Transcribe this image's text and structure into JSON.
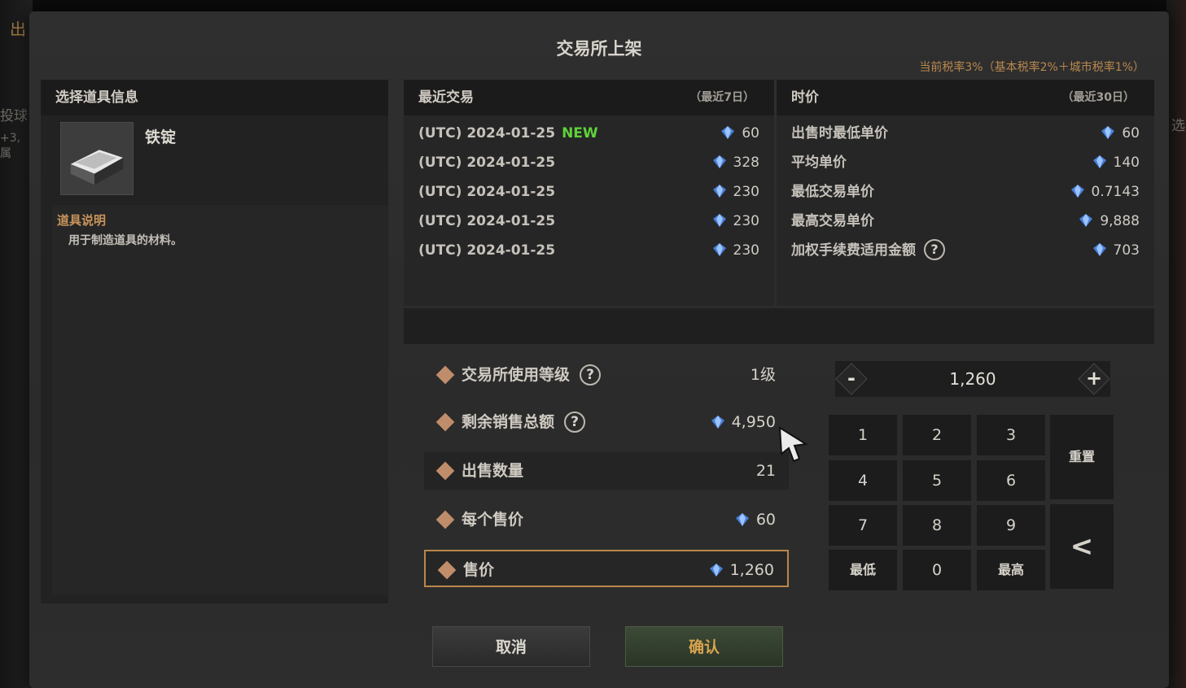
{
  "background": {
    "left_fragments": [
      "出",
      "投球",
      "+3, 属"
    ],
    "right_fragment": "选"
  },
  "dialog": {
    "title": "交易所上架",
    "tax_info": "当前税率3%（基本税率2%＋城市税率1%）"
  },
  "item_info": {
    "header": "选择道具信息",
    "name": "铁锭",
    "icon": "iron-ingot-icon",
    "description_title": "道具说明",
    "description": "用于制造道具的材料。"
  },
  "recent_trades": {
    "header": "最近交易",
    "period": "（最近7日）",
    "rows": [
      {
        "date": "(UTC) 2024-01-25",
        "new": "NEW",
        "price": "60"
      },
      {
        "date": "(UTC) 2024-01-25",
        "new": "",
        "price": "328"
      },
      {
        "date": "(UTC) 2024-01-25",
        "new": "",
        "price": "230"
      },
      {
        "date": "(UTC) 2024-01-25",
        "new": "",
        "price": "230"
      },
      {
        "date": "(UTC) 2024-01-25",
        "new": "",
        "price": "230"
      }
    ]
  },
  "market_price": {
    "header": "时价",
    "period": "（最近30日）",
    "rows": [
      {
        "label": "出售时最低单价",
        "value": "60"
      },
      {
        "label": "平均单价",
        "value": "140"
      },
      {
        "label": "最低交易单价",
        "value": "0.7143"
      },
      {
        "label": "最高交易单价",
        "value": "9,888"
      },
      {
        "label": "加权手续费适用金额",
        "value": "703"
      }
    ]
  },
  "listing": {
    "usage_level_label": "交易所使用等级",
    "usage_level_value": "1级",
    "remaining_total_label": "剩余销售总额",
    "remaining_total_value": "4,950",
    "sell_qty_label": "出售数量",
    "sell_qty_value": "21",
    "unit_price_label": "每个售价",
    "unit_price_value": "60",
    "total_price_label": "售价",
    "total_price_value": "1,260"
  },
  "keypad": {
    "display": "1,260",
    "minus": "-",
    "plus": "+",
    "keys": [
      "1",
      "2",
      "3",
      "4",
      "5",
      "6",
      "7",
      "8",
      "9",
      "最低",
      "0",
      "最高"
    ],
    "reset": "重置",
    "backspace": "<"
  },
  "buttons": {
    "cancel": "取消",
    "confirm": "确认"
  },
  "colors": {
    "accent_gold": "#c9955b",
    "new_green": "#5fd23a",
    "selected_border": "#b9874a"
  }
}
